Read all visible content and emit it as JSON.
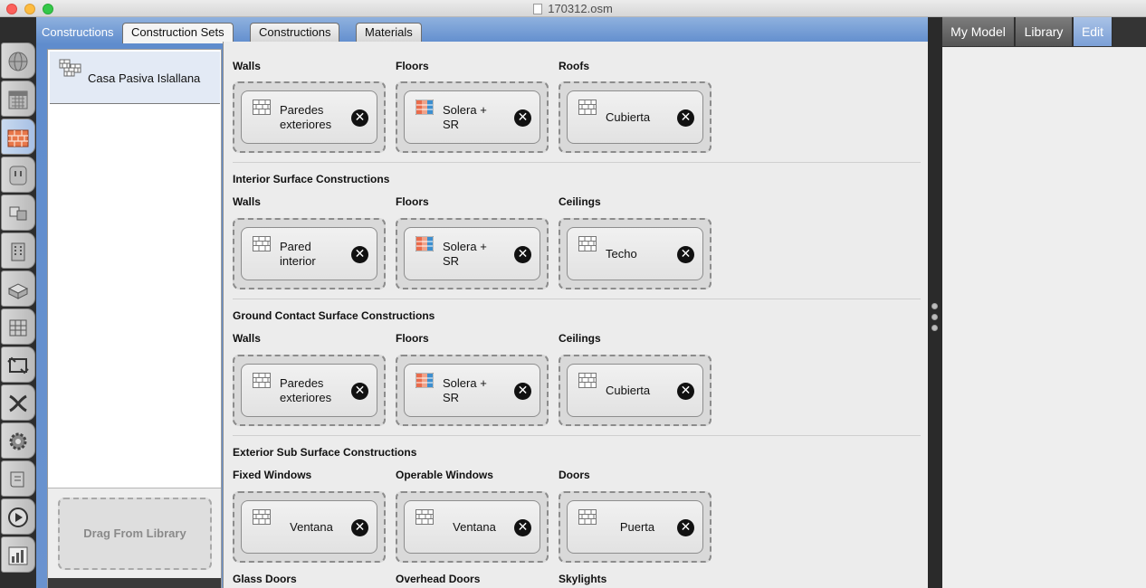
{
  "window": {
    "title": "170312.osm"
  },
  "tabs": {
    "main_label": "Constructions",
    "construction_sets": "Construction Sets",
    "constructions": "Constructions",
    "materials": "Materials"
  },
  "list": {
    "selected_item": "Casa Pasiva Islallana",
    "drag_label": "Drag From Library"
  },
  "right_tabs": {
    "my_model": "My Model",
    "library": "Library",
    "edit": "Edit"
  },
  "remove_glyph": "✕",
  "groups": {
    "exterior": {
      "title": "",
      "walls": {
        "label": "Walls",
        "item": "Paredes exteriores",
        "icon": "brick-icon"
      },
      "floors": {
        "label": "Floors",
        "item": "Solera + SR",
        "icon": "layered-material-icon"
      },
      "roofs": {
        "label": "Roofs",
        "item": "Cubierta",
        "icon": "brick-icon"
      }
    },
    "interior": {
      "title": "Interior Surface Constructions",
      "walls": {
        "label": "Walls",
        "item": "Pared interior"
      },
      "floors": {
        "label": "Floors",
        "item": "Solera + SR"
      },
      "ceilings": {
        "label": "Ceilings",
        "item": "Techo"
      }
    },
    "ground": {
      "title": "Ground Contact Surface Constructions",
      "walls": {
        "label": "Walls",
        "item": "Paredes exteriores"
      },
      "floors": {
        "label": "Floors",
        "item": "Solera + SR"
      },
      "ceilings": {
        "label": "Ceilings",
        "item": "Cubierta"
      }
    },
    "subsurface": {
      "title": "Exterior Sub Surface Constructions",
      "fixed_windows": {
        "label": "Fixed Windows",
        "item": "Ventana"
      },
      "operable_windows": {
        "label": "Operable Windows",
        "item": "Ventana"
      },
      "doors": {
        "label": "Doors",
        "item": "Puerta"
      }
    },
    "more": {
      "glass_doors": "Glass Doors",
      "overhead_doors": "Overhead Doors",
      "skylights": "Skylights"
    }
  },
  "colors": {
    "accent_blue": "#6a93cf",
    "selected_tab_blue": "#7b9fd6"
  }
}
